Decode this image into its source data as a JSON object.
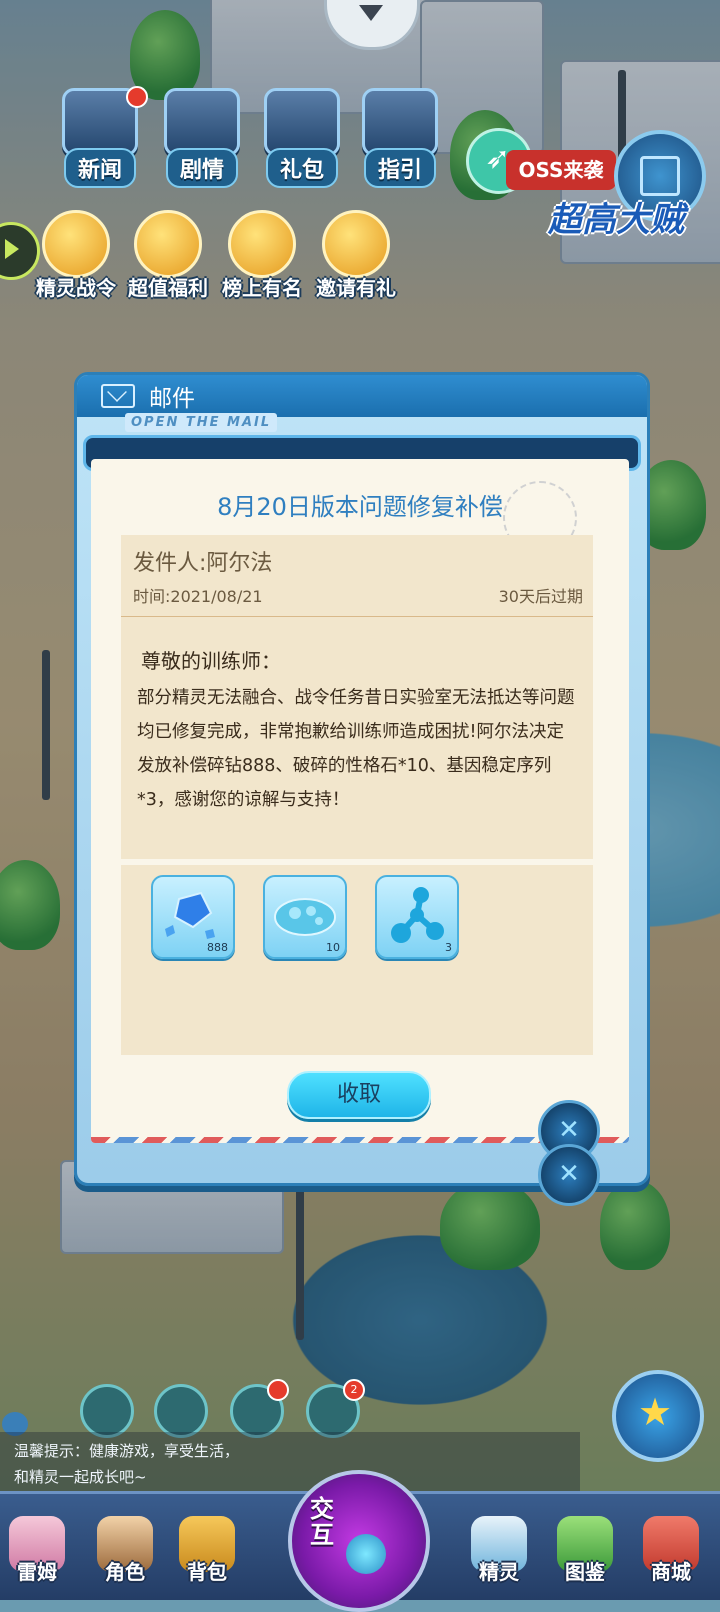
{
  "top_menu": [
    {
      "label": "新闻",
      "icon": "newspaper-icon",
      "badge": true
    },
    {
      "label": "剧情",
      "icon": "story-book-icon",
      "badge": false
    },
    {
      "label": "礼包",
      "icon": "gift-chest-icon",
      "badge": false
    },
    {
      "label": "指引",
      "icon": "guide-book-icon",
      "badge": false
    }
  ],
  "features": [
    {
      "label": "精灵战令",
      "icon": "battle-pass-icon"
    },
    {
      "label": "超值福利",
      "icon": "welfare-gift-icon"
    },
    {
      "label": "榜上有名",
      "icon": "trophy-icon"
    },
    {
      "label": "邀请有礼",
      "icon": "invitation-icon"
    }
  ],
  "boss_banner": "OSS来袭",
  "scene_banner": "超高大贼",
  "mail": {
    "header_title": "邮件",
    "open_tag": "OPEN THE MAIL",
    "title": "8月20日版本问题修复补偿",
    "sender": "发件人:阿尔法",
    "time": "时间:2021/08/21",
    "expire": "30天后过期",
    "greeting": "尊敬的训练师：",
    "content": "部分精灵无法融合、战令任务昔日实验室无法抵达等问题均已修复完成，非常抱歉给训练师造成困扰!阿尔法决定发放补偿碎钻888、破碎的性格石*10、基因稳定序列*3，感谢您的谅解与支持！",
    "attachments": [
      {
        "name": "碎钻",
        "icon": "crystal-shard-icon",
        "count": "888"
      },
      {
        "name": "破碎的性格石",
        "icon": "broken-stone-icon",
        "count": "10"
      },
      {
        "name": "基因稳定序列",
        "icon": "gene-molecule-icon",
        "count": "3"
      }
    ],
    "claim_label": "收取"
  },
  "side_badge_count": "2",
  "tip": {
    "line1": "温馨提示：健康游戏，享受生活，",
    "line2": "和精灵一起成长吧~"
  },
  "bottom_nav": [
    {
      "label": "雷姆",
      "icon": "pet-avatar-icon"
    },
    {
      "label": "角色",
      "icon": "character-icon"
    },
    {
      "label": "背包",
      "icon": "backpack-icon"
    },
    {
      "label": "精灵",
      "icon": "spirit-icon"
    },
    {
      "label": "图鉴",
      "icon": "codex-icon"
    },
    {
      "label": "商城",
      "icon": "shop-icon"
    }
  ],
  "center_button": {
    "label_line1": "交",
    "label_line2": "互"
  },
  "colors": {
    "accent": "#2f7fc0",
    "claim": "#1fb5e8",
    "frame": "#2c7fb8"
  }
}
